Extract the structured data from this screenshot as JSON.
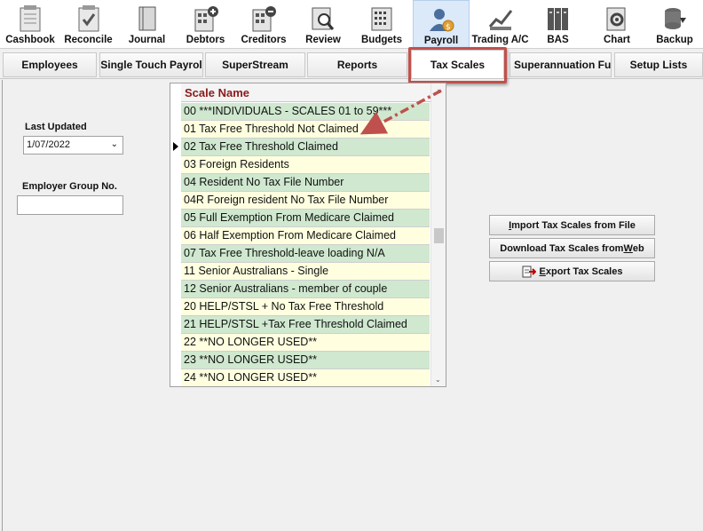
{
  "toolbar": {
    "items": [
      {
        "label": "Cashbook",
        "icon": "cashbook-icon"
      },
      {
        "label": "Reconcile",
        "icon": "reconcile-icon"
      },
      {
        "label": "Journal",
        "icon": "journal-icon"
      },
      {
        "label": "Debtors",
        "icon": "debtors-icon"
      },
      {
        "label": "Creditors",
        "icon": "creditors-icon"
      },
      {
        "label": "Review",
        "icon": "review-icon"
      },
      {
        "label": "Budgets",
        "icon": "budgets-icon"
      },
      {
        "label": "Payroll",
        "icon": "payroll-icon",
        "active": true
      },
      {
        "label": "Trading A/C",
        "icon": "trading-icon"
      },
      {
        "label": "BAS",
        "icon": "bas-icon"
      },
      {
        "label": "Chart",
        "icon": "chart-icon"
      },
      {
        "label": "Backup",
        "icon": "backup-icon"
      }
    ]
  },
  "tabs": [
    {
      "label": "Employees"
    },
    {
      "label": "Single Touch Payrol"
    },
    {
      "label": "SuperStream"
    },
    {
      "label": "Reports"
    },
    {
      "label": "Tax Scales",
      "selected": true
    },
    {
      "label": "Superannuation Fun"
    },
    {
      "label": "Setup Lists"
    }
  ],
  "left_panel": {
    "last_updated_label": "Last Updated",
    "last_updated_value": "1/07/2022",
    "employer_group_label": "Employer Group No.",
    "employer_group_value": ""
  },
  "grid": {
    "header": "Scale Name",
    "rows": [
      "00  ***INDIVIDUALS - SCALES 01 to 59***",
      "01 Tax Free Threshold Not Claimed",
      "02 Tax Free Threshold Claimed",
      "03 Foreign Residents",
      "04 Resident No Tax File Number",
      "04R Foreign resident No Tax File Number",
      "05 Full Exemption From Medicare Claimed",
      "06 Half Exemption From Medicare Claimed",
      "07 Tax Free Threshold-leave loading N/A",
      "11 Senior Australians - Single",
      "12 Senior Australians - member of couple",
      "20 HELP/STSL + No Tax Free Threshold",
      "21 HELP/STSL +Tax Free Threshold Claimed",
      "22 **NO LONGER USED**",
      "23 **NO LONGER USED**",
      "24 **NO LONGER USED**"
    ]
  },
  "actions": {
    "import": {
      "pre": "",
      "u": "I",
      "post": "mport Tax Scales from File"
    },
    "download": {
      "pre": "Download Tax Scales from ",
      "u": "W",
      "post": "eb"
    },
    "export": {
      "pre": "",
      "u": "E",
      "post": "xport Tax Scales"
    }
  },
  "colors": {
    "row_green": "#cfe8cf",
    "row_yellow": "#ffffe0",
    "header_text": "#8b1a1a",
    "annotation_red": "#c0504d",
    "active_toolbar": "#dbe9f9"
  }
}
